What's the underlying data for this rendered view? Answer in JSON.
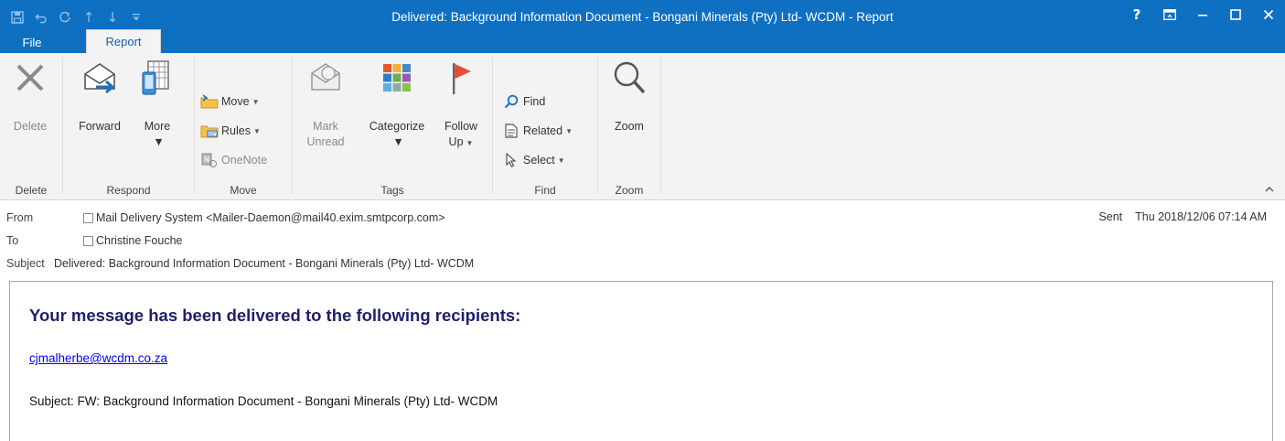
{
  "window": {
    "title": "Delivered: Background Information Document - Bongani Minerals (Pty) Ltd- WCDM - Report",
    "controls": {
      "help": "?",
      "restore_ribbon": "⊡",
      "minimize": "–",
      "maximize": "☐",
      "close": "✕"
    }
  },
  "qat": {
    "save": "💾",
    "undo": "↶",
    "redo": "↻",
    "up": "↑",
    "down": "↓",
    "customize": "▾"
  },
  "tabs": [
    {
      "label": "File"
    },
    {
      "label": "Report",
      "active": true
    }
  ],
  "ribbon": {
    "groups": {
      "delete": "Delete",
      "respond": "Respond",
      "move": "Move",
      "tags": "Tags",
      "find": "Find",
      "zoom": "Zoom"
    },
    "buttons": {
      "delete": "Delete",
      "forward": "Forward",
      "more": "More",
      "move": "Move",
      "rules": "Rules",
      "onenote": "OneNote",
      "mark_unread_1": "Mark",
      "mark_unread_2": "Unread",
      "categorize": "Categorize",
      "follow_up_1": "Follow",
      "follow_up_2": "Up",
      "find": "Find",
      "related": "Related",
      "select": "Select",
      "zoom": "Zoom"
    }
  },
  "header": {
    "from_label": "From",
    "from_value": "Mail Delivery System <Mailer-Daemon@mail40.exim.smtpcorp.com>",
    "to_label": "To",
    "to_value": "Christine Fouche",
    "subject_label": "Subject",
    "subject_value": "Delivered: Background Information Document - Bongani Minerals (Pty) Ltd- WCDM",
    "sent_label": "Sent",
    "sent_value": "Thu 2018/12/06 07:14 AM"
  },
  "message": {
    "heading": "Your message has been delivered to the following recipients:",
    "recipient": "cjmalherbe@wcdm.co.za",
    "subject_line": "Subject: FW: Background Information Document - Bongani Minerals (Pty) Ltd- WCDM"
  },
  "colors": {
    "titlebar": "#0f70c2",
    "ribbon_bg": "#f3f3f3",
    "heading": "#1f1f6b",
    "link": "#0000ee"
  }
}
